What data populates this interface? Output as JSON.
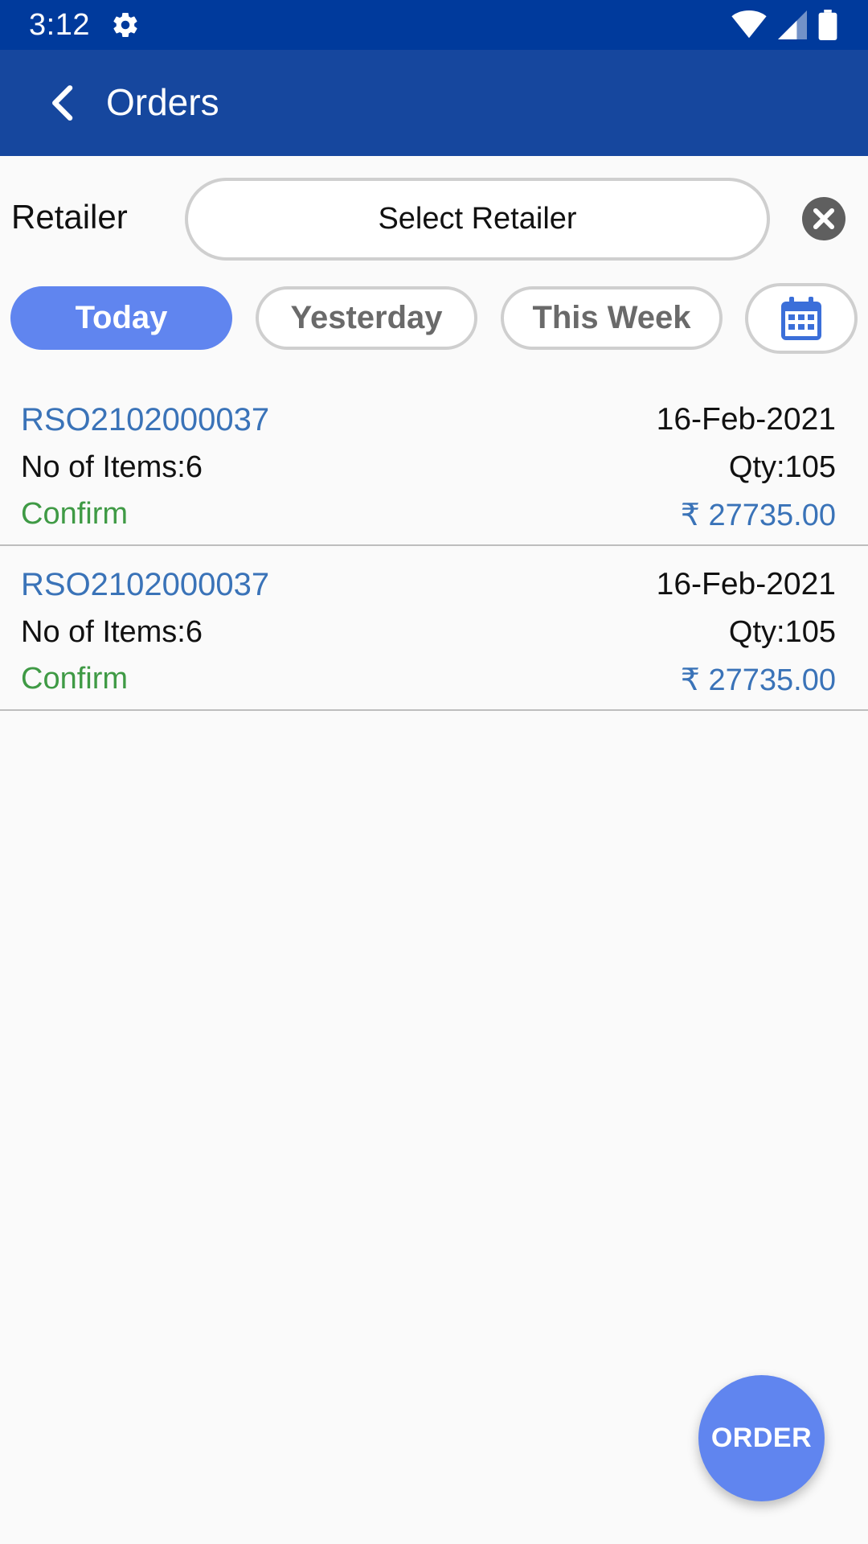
{
  "status_bar": {
    "time": "3:12"
  },
  "header": {
    "title": "Orders"
  },
  "filter": {
    "retailer_label": "Retailer",
    "retailer_select": "Select Retailer",
    "pills": [
      "Today",
      "Yesterday",
      "This Week"
    ],
    "active_pill": "Today"
  },
  "orders": [
    {
      "id": "RSO2102000037",
      "date": "16-Feb-2021",
      "items": "No of Items:6",
      "qty": "Qty:105",
      "status": "Confirm",
      "amount": "₹ 27735.00"
    },
    {
      "id": "RSO2102000037",
      "date": "16-Feb-2021",
      "items": "No of Items:6",
      "qty": "Qty:105",
      "status": "Confirm",
      "amount": "₹ 27735.00"
    }
  ],
  "fab": {
    "label": "ORDER"
  },
  "colors": {
    "status_bar": "#003a9c",
    "app_bar": "#16479e",
    "accent": "#6085ef",
    "link_blue": "#3a73b8",
    "confirm_green": "#3f9a45"
  },
  "icons": [
    "gear-icon",
    "wifi-icon",
    "signal-icon",
    "battery-icon",
    "back-arrow-icon",
    "clear-icon",
    "calendar-icon"
  ]
}
